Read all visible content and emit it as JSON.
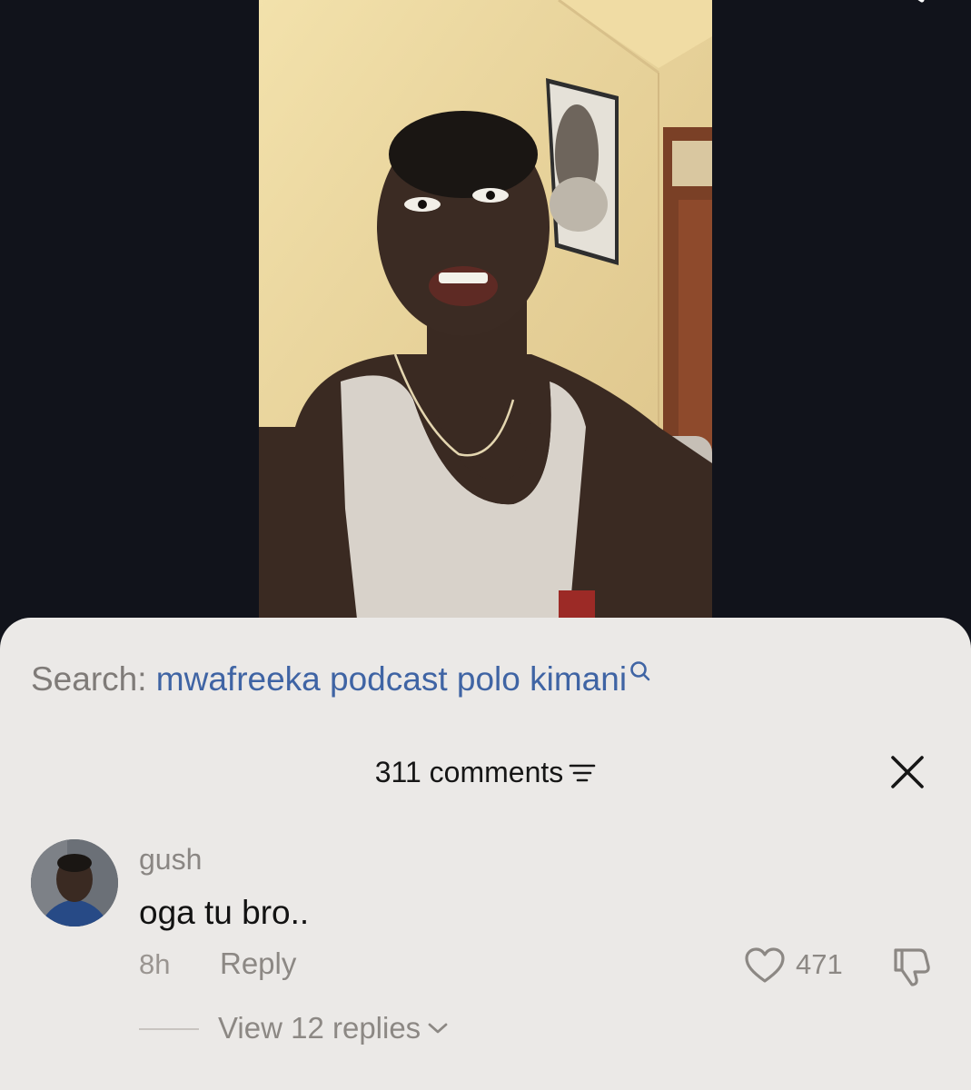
{
  "search": {
    "prefix": "Search:",
    "query": "mwafreeka podcast polo kimani"
  },
  "comments_panel": {
    "count_label": "311 comments"
  },
  "comment": {
    "username": "gush",
    "text": "oga tu bro..",
    "time": "8h",
    "reply_label": "Reply",
    "like_count": "471",
    "view_replies_label": "View 12 replies"
  },
  "colors": {
    "sheet_background": "#ebe9e7",
    "video_background": "#11131b",
    "search_query": "#3f64a4",
    "muted_text": "#8c8884"
  },
  "icons": [
    "search-icon",
    "filter-icon",
    "close-icon",
    "heart-icon",
    "dislike-icon",
    "chevron-down-icon"
  ]
}
